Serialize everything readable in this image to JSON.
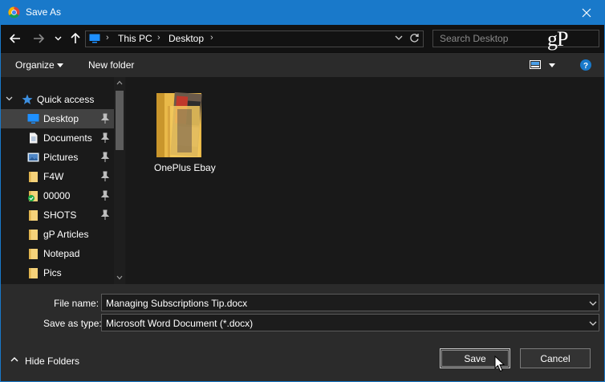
{
  "window": {
    "title": "Save As"
  },
  "address": {
    "crumbs": [
      "This PC",
      "Desktop"
    ]
  },
  "search": {
    "placeholder": "Search Desktop"
  },
  "logo": {
    "text": "gP"
  },
  "toolbar": {
    "organize_label": "Organize",
    "new_folder_label": "New folder"
  },
  "nav": {
    "quick_access_label": "Quick access",
    "items": [
      {
        "label": "Desktop",
        "icon": "desktop-icon",
        "pinned": true,
        "selected": true
      },
      {
        "label": "Documents",
        "icon": "documents-icon",
        "pinned": true
      },
      {
        "label": "Pictures",
        "icon": "pictures-icon",
        "pinned": true
      },
      {
        "label": "F4W",
        "icon": "folder-icon",
        "pinned": true
      },
      {
        "label": "00000",
        "icon": "synced-folder-icon",
        "pinned": true
      },
      {
        "label": "SHOTS",
        "icon": "folder-icon",
        "pinned": true
      },
      {
        "label": "gP Articles",
        "icon": "folder-icon",
        "pinned": false
      },
      {
        "label": "Notepad",
        "icon": "folder-icon",
        "pinned": false
      },
      {
        "label": "Pics",
        "icon": "folder-icon",
        "pinned": false
      }
    ]
  },
  "content": {
    "items": [
      {
        "label": "OnePlus Ebay",
        "type": "folder"
      }
    ]
  },
  "form": {
    "file_name_label": "File name:",
    "file_name_value": "Managing Subscriptions Tip.docx",
    "save_type_label": "Save as type:",
    "save_type_value": "Microsoft Word Document (*.docx)"
  },
  "footer": {
    "hide_folders_label": "Hide Folders",
    "save_label": "Save",
    "cancel_label": "Cancel"
  },
  "colors": {
    "accent": "#1979ca",
    "background": "#191919",
    "panel": "#2b2b2b"
  }
}
